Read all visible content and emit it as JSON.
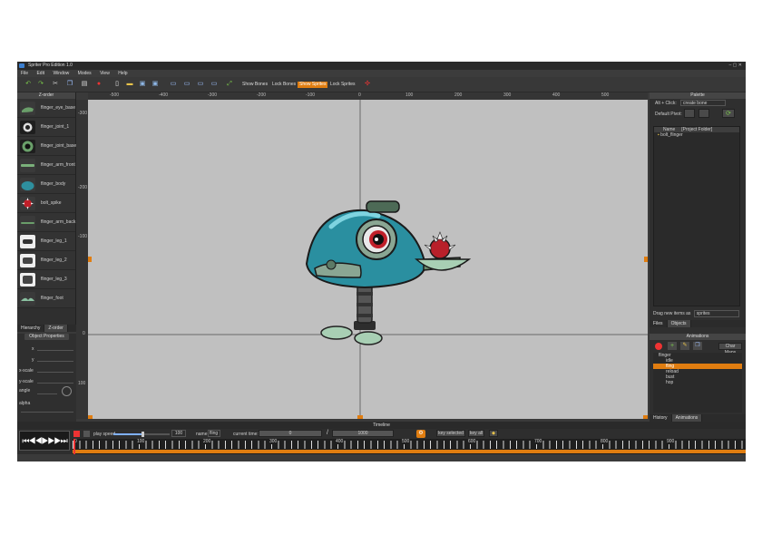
{
  "window": {
    "title": "Spriter Pro Edition 1.0"
  },
  "menu": [
    "File",
    "Edit",
    "Window",
    "Modes",
    "View",
    "Help"
  ],
  "toolbar": {
    "show_bones": "Show Bones",
    "lock_bones": "Lock Bones",
    "show_sprites": "Show Sprites",
    "lock_sprites": "Lock Sprites"
  },
  "zorder": {
    "title": "Z-order",
    "items": [
      "flinger_eye_base",
      "flinger_joint_1",
      "flinger_joint_base",
      "flinger_arm_front",
      "flinger_body",
      "bolt_spike",
      "flinger_arm_back",
      "flinger_leg_1",
      "flinger_leg_2",
      "flinger_leg_3",
      "flinger_foot"
    ],
    "tabs": [
      "Hierarchy",
      "Z-order"
    ]
  },
  "object_properties": {
    "title": "Object Properties",
    "fields": [
      "x",
      "y",
      "x-scale",
      "y-scale",
      "angle",
      "alpha"
    ]
  },
  "ruler": {
    "h": [
      "-500",
      "-400",
      "-300",
      "-200",
      "-100",
      "0",
      "100",
      "200",
      "300",
      "400",
      "500"
    ],
    "v": [
      "-300",
      "-200",
      "-100",
      "0",
      "100"
    ]
  },
  "palette": {
    "title": "Palette",
    "hint": "Alt + Click:",
    "hint_action": "create bone",
    "default_pivot": "Default Pivot:",
    "name_col": "Name",
    "project_folder": "[Project Folder]",
    "folder": "bolt_flinger",
    "drag_hint": "Drag new items as",
    "drag_value": "sprites",
    "tabs": [
      "Files",
      "Objects"
    ]
  },
  "animations": {
    "title": "Animations",
    "char_maps": "Char Maps",
    "entity": "flinger",
    "items": [
      "idle",
      "fling",
      "reload",
      "bust",
      "hop"
    ],
    "selected": "fling",
    "tabs": [
      "History",
      "Animations"
    ]
  },
  "timeline": {
    "title": "Timeline",
    "play_speed_label": "play speed",
    "play_speed": "100",
    "name_label": "name",
    "name_value": "fling",
    "current_time_label": "current time:",
    "current_time": "0",
    "separator": "/",
    "total_time": "1000",
    "key_selected": "key selected",
    "key_all": "key all",
    "ticks": [
      "0",
      "100",
      "200",
      "300",
      "400",
      "500",
      "600",
      "700",
      "800",
      "900"
    ]
  },
  "colors": {
    "accent": "#e07d10",
    "canvas": "#c0c0c0",
    "panel": "#2f2f2f"
  }
}
